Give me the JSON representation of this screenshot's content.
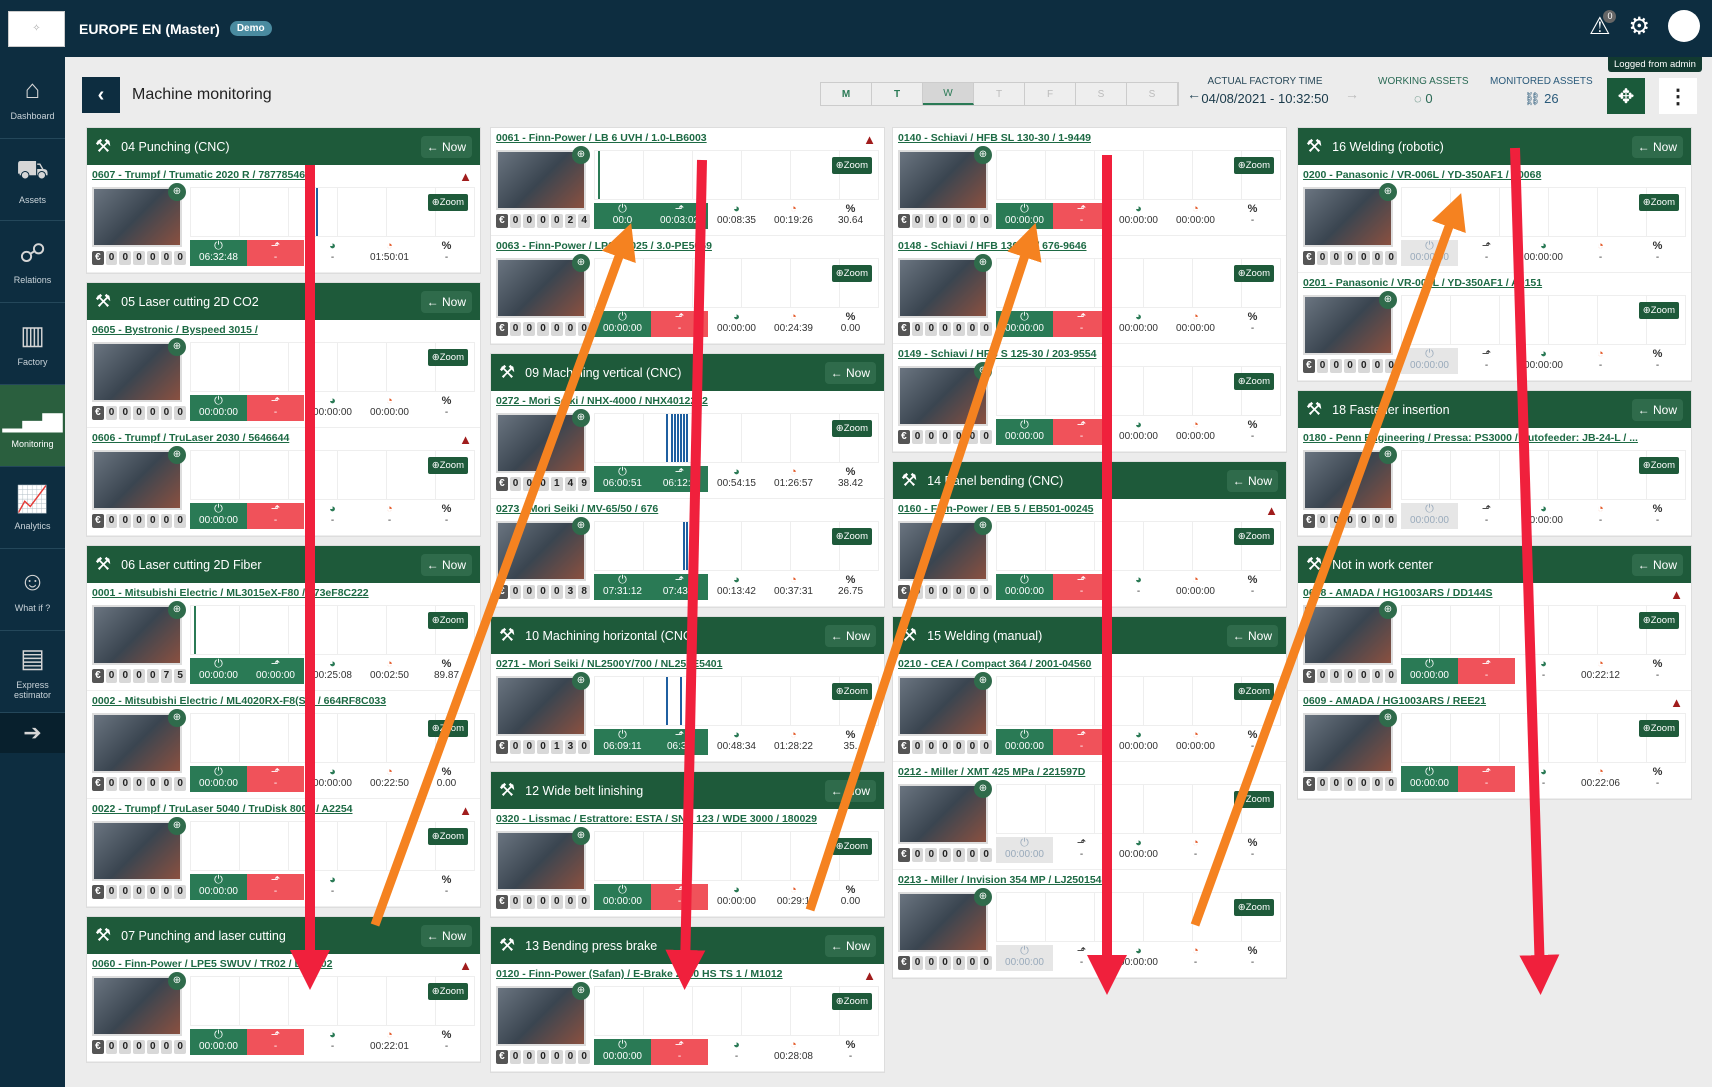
{
  "topbar": {
    "org": "EUROPE EN (Master)",
    "badge": "Demo",
    "notif_count": "0",
    "logged": "Logged from admin"
  },
  "sidebar": [
    {
      "label": "Dashboard",
      "icon": "home-icon",
      "glyph": "⌂"
    },
    {
      "label": "Assets",
      "icon": "assets-icon",
      "glyph": "⛟"
    },
    {
      "label": "Relations",
      "icon": "relations-icon",
      "glyph": "☍"
    },
    {
      "label": "Factory",
      "icon": "factory-icon",
      "glyph": "▥"
    },
    {
      "label": "Monitoring",
      "icon": "monitoring-icon",
      "glyph": "▁▃▅",
      "active": true
    },
    {
      "label": "Analytics",
      "icon": "analytics-icon",
      "glyph": "📈"
    },
    {
      "label": "What if ?",
      "icon": "whatif-icon",
      "glyph": "☺"
    },
    {
      "label": "Express estimator",
      "icon": "estimator-icon",
      "glyph": "▤"
    }
  ],
  "page": {
    "title": "Machine monitoring"
  },
  "days": [
    {
      "l": "M",
      "s": "on"
    },
    {
      "l": "T",
      "s": "on"
    },
    {
      "l": "W",
      "s": "sel"
    },
    {
      "l": "T",
      "s": ""
    },
    {
      "l": "F",
      "s": ""
    },
    {
      "l": "S",
      "s": ""
    },
    {
      "l": "S",
      "s": ""
    }
  ],
  "factory_time": {
    "label": "ACTUAL FACTORY TIME",
    "value": "04/08/2021 - 10:32:50"
  },
  "working_assets": {
    "label": "WORKING ASSETS",
    "value": "0"
  },
  "monitored_assets": {
    "label": "MONITORED ASSETS",
    "value": "26"
  },
  "now_label": "Now",
  "zoom_label": "Zoom",
  "columns": [
    [
      {
        "title": "04 Punching (CNC)",
        "machines": [
          {
            "name": "0607 - Trumpf / Trumatic 2020 R / 78778546",
            "warn": true,
            "cost": "000000",
            "m": [
              "06:32:48",
              "-",
              "-",
              "01:50:01",
              "-"
            ],
            "st": [
              "g",
              "r"
            ],
            "bars": [
              0.44
            ]
          }
        ]
      },
      {
        "title": "05 Laser cutting 2D CO2",
        "machines": [
          {
            "name": "0605 - Bystronic / Byspeed 3015 /",
            "warn": false,
            "cost": "000000",
            "m": [
              "00:00:00",
              "-",
              "00:00:00",
              "00:00:00",
              "-"
            ],
            "st": [
              "g",
              "r"
            ],
            "bars": []
          },
          {
            "name": "0606 - Trumpf / TruLaser 2030 / 5646644",
            "warn": true,
            "cost": "000000",
            "m": [
              "00:00:00",
              "-",
              "-",
              "-",
              "-"
            ],
            "st": [
              "g",
              "r"
            ],
            "bars": []
          }
        ]
      },
      {
        "title": "06 Laser cutting 2D Fiber",
        "machines": [
          {
            "name": "0001 - Mitsubishi Electric / ML3015eX-F80 / 173eF8C222",
            "warn": false,
            "cost": "000075",
            "m": [
              "00:00:00",
              "00:00:00",
              "00:25:08",
              "00:02:50",
              "89.87"
            ],
            "st": [
              "g",
              "g"
            ],
            "bars": [
              0.01
            ]
          },
          {
            "name": "0002 - Mitsubishi Electric / ML4020RX-F8(S2) / 664RF8C033",
            "warn": false,
            "cost": "000000",
            "m": [
              "00:00:00",
              "-",
              "00:00:00",
              "00:22:50",
              "0.00"
            ],
            "st": [
              "g",
              "r"
            ],
            "bars": []
          },
          {
            "name": "0022 - Trumpf / TruLaser 5040 / TruDisk 8001 / A2254",
            "warn": true,
            "cost": "000000",
            "m": [
              "00:00:00",
              "-",
              "-",
              "-",
              "-"
            ],
            "st": [
              "g",
              "r"
            ],
            "bars": []
          }
        ]
      },
      {
        "title": "07 Punching and laser cutting",
        "machines": [
          {
            "name": "0060 - Finn-Power / LPE5 SWUV / TR02 / LPE502",
            "warn": true,
            "cost": "000000",
            "m": [
              "00:00:00",
              "-",
              "-",
              "00:22:01",
              "-"
            ],
            "st": [
              "g",
              "r"
            ],
            "bars": []
          }
        ]
      }
    ],
    [
      {
        "title": "",
        "machines": [
          {
            "name": "0061 - Finn-Power / LB 6 UVH / 1.0-LB6003",
            "warn": true,
            "cost": "000024",
            "m": [
              "00:0",
              "00:03:02",
              "00:08:35",
              "00:19:26",
              "30.64"
            ],
            "st": [
              "g",
              "g"
            ],
            "bars": [
              0.01
            ]
          },
          {
            "name": "0063 - Finn-Power / LP6 / C025 / 3.0-PE5069",
            "warn": false,
            "cost": "000000",
            "m": [
              "00:00:00",
              "-",
              "00:00:00",
              "00:24:39",
              "0.00"
            ],
            "st": [
              "g",
              "r"
            ],
            "bars": []
          }
        ]
      },
      {
        "title": "09 Machining vertical (CNC)",
        "machines": [
          {
            "name": "0272 - Mori Seiki / NHX-4000 / NHX4012202",
            "warn": false,
            "cost": "000149",
            "m": [
              "06:00:51",
              "06:12:2",
              "00:54:15",
              "01:26:57",
              "38.42"
            ],
            "st": [
              "g",
              "g"
            ],
            "bars": [
              0.25,
              0.27,
              0.28,
              0.29,
              0.3,
              0.31,
              0.32
            ]
          },
          {
            "name": "0273 - Mori Seiki / MV-65/50 / 676",
            "warn": false,
            "cost": "000038",
            "m": [
              "07:31:12",
              "07:43:1",
              "00:13:42",
              "00:37:31",
              "26.75"
            ],
            "st": [
              "g",
              "g"
            ],
            "bars": [
              0.31,
              0.32
            ]
          }
        ]
      },
      {
        "title": "10 Machining horizontal (CNC)",
        "machines": [
          {
            "name": "0271 - Mori Seiki / NL2500Y/700 / NL25JE5401",
            "warn": false,
            "cost": "000130",
            "m": [
              "06:09:11",
              "06:35",
              "00:48:34",
              "01:28:22",
              "35."
            ],
            "st": [
              "g",
              "g"
            ],
            "bars": [
              0.25,
              0.3
            ]
          }
        ]
      },
      {
        "title": "12 Wide belt linishing",
        "machines": [
          {
            "name": "0320 - Lissmac / Estrattore: ESTA / SND 123 / WDE 3000 / 180029",
            "warn": false,
            "cost": "000000",
            "m": [
              "00:00:00",
              "-",
              "00:00:00",
              "00:29:1",
              "0.00"
            ],
            "st": [
              "g",
              "r"
            ],
            "bars": []
          }
        ]
      },
      {
        "title": "13 Bending press brake",
        "machines": [
          {
            "name": "0120 - Finn-Power (Safan) / E-Brake 2050 HS TS 1 / M1012",
            "warn": true,
            "cost": "000000",
            "m": [
              "00:00:00",
              "-",
              "-",
              "00:28:08",
              "-"
            ],
            "st": [
              "g",
              "r"
            ],
            "bars": []
          }
        ]
      }
    ],
    [
      {
        "title": "",
        "machines": [
          {
            "name": "0140 - Schiavi / HFB SL 130-30 / 1-9449",
            "warn": false,
            "cost": "000000",
            "m": [
              "00:00:00",
              "-",
              "00:00:00",
              "00:00:00",
              "-"
            ],
            "st": [
              "g",
              "r"
            ],
            "bars": []
          },
          {
            "name": "0148 - Schiavi / HFB 130-30 / 676-9646",
            "warn": false,
            "cost": "000000",
            "m": [
              "00:00:00",
              "-",
              "00:00:00",
              "00:00:00",
              "-"
            ],
            "st": [
              "g",
              "r"
            ],
            "bars": []
          },
          {
            "name": "0149 - Schiavi / HFB S 125-30 / 203-9554",
            "warn": false,
            "cost": "000000",
            "m": [
              "00:00:00",
              "-",
              "00:00:00",
              "00:00:00",
              "-"
            ],
            "st": [
              "g",
              "r"
            ],
            "bars": []
          }
        ]
      },
      {
        "title": "14 Panel bending (CNC)",
        "machines": [
          {
            "name": "0160 - Finn-Power / EB 5 / EB501-00245",
            "warn": true,
            "cost": "000000",
            "m": [
              "00:00:00",
              "-",
              "-",
              "00:00:00",
              "-"
            ],
            "st": [
              "g",
              "r"
            ],
            "bars": []
          }
        ]
      },
      {
        "title": "15 Welding (manual)",
        "machines": [
          {
            "name": "0210 - CEA / Compact 364 / 2001-04560",
            "warn": false,
            "cost": "000000",
            "m": [
              "00:00:00",
              "-",
              "00:00:00",
              "00:00:00",
              "-"
            ],
            "st": [
              "g",
              "r"
            ],
            "bars": []
          },
          {
            "name": "0212 - Miller / XMT 425 MPa / 221597D",
            "warn": false,
            "cost": "000000",
            "m": [
              "00:00:00",
              "-",
              "00:00:00",
              "-",
              "-"
            ],
            "st": [
              "grey",
              ""
            ],
            "bars": []
          },
          {
            "name": "0213 - Miller / Invision 354 MP / LJ250154A",
            "warn": false,
            "cost": "000000",
            "m": [
              "00:00:00",
              "-",
              "00:00:00",
              "-",
              "-"
            ],
            "st": [
              "grey",
              ""
            ],
            "bars": []
          }
        ]
      }
    ],
    [
      {
        "title": "16 Welding (robotic)",
        "machines": [
          {
            "name": "0200 - Panasonic / VR-006L / YD-350AF1 / T0068",
            "warn": false,
            "cost": "000000",
            "m": [
              "00:00:00",
              "-",
              "00:00:00",
              "-",
              "-"
            ],
            "st": [
              "grey",
              ""
            ],
            "bars": []
          },
          {
            "name": "0201 - Panasonic / VR-006L / YD-350AF1 / A0151",
            "warn": false,
            "cost": "000000",
            "m": [
              "00:00:00",
              "-",
              "00:00:00",
              "-",
              "-"
            ],
            "st": [
              "grey",
              ""
            ],
            "bars": []
          }
        ]
      },
      {
        "title": "18 Fastener insertion",
        "machines": [
          {
            "name": "0180 - Penn Engineering / Pressa: PS3000 / Autofeeder: JB-24-L / ...",
            "warn": false,
            "cost": "000000",
            "m": [
              "00:00:00",
              "-",
              "00:00:00",
              "-",
              "-"
            ],
            "st": [
              "grey",
              ""
            ],
            "bars": []
          }
        ]
      },
      {
        "title": "Not in work center",
        "machines": [
          {
            "name": "0608 - AMADA / HG1003ARS / DD144S",
            "warn": true,
            "cost": "000000",
            "m": [
              "00:00:00",
              "-",
              "-",
              "00:22:12",
              "-"
            ],
            "st": [
              "g",
              "r"
            ],
            "bars": []
          },
          {
            "name": "0609 - AMADA / HG1003ARS / REE21",
            "warn": true,
            "cost": "000000",
            "m": [
              "00:00:00",
              "-",
              "-",
              "00:22:06",
              "-"
            ],
            "st": [
              "g",
              "r"
            ],
            "bars": []
          }
        ]
      }
    ]
  ]
}
